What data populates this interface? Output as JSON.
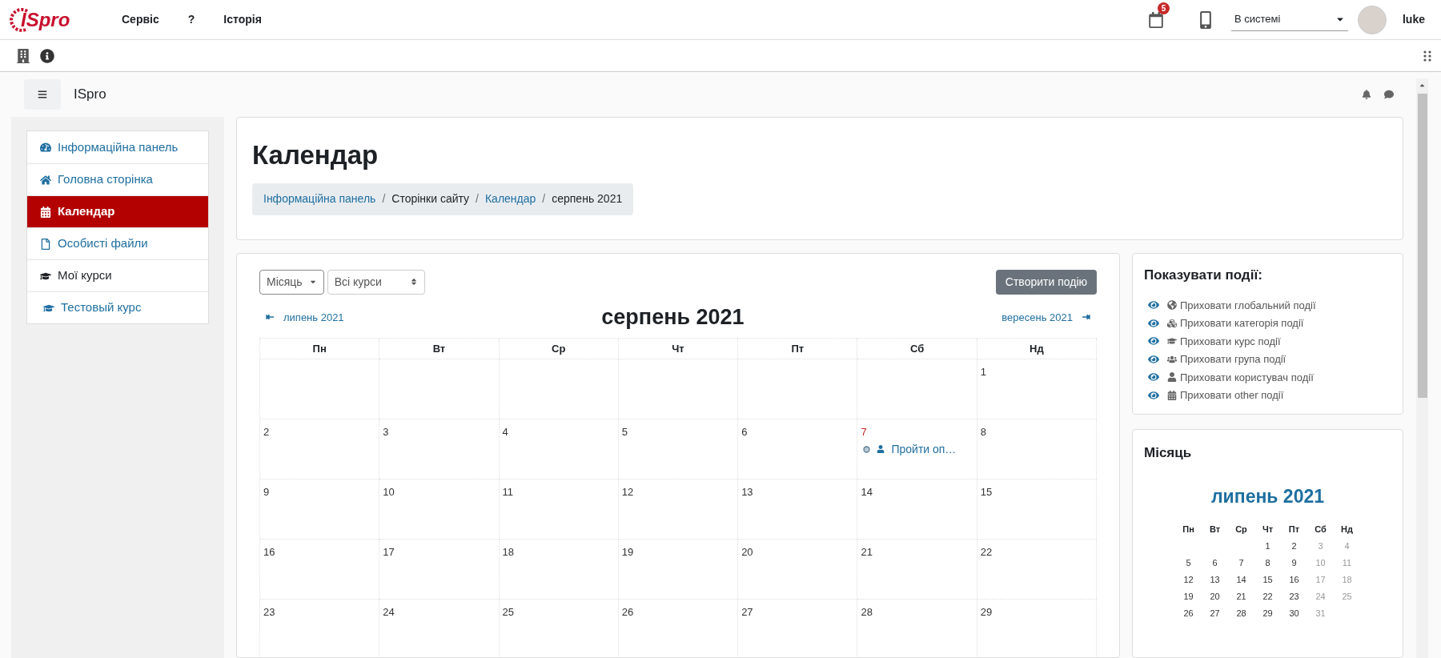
{
  "top_bar": {
    "logo": "ISpro",
    "menu": [
      "Сервіс",
      "?",
      "Історія"
    ],
    "notification_count": "5",
    "status_select": {
      "value": "В системі"
    },
    "user": "luke"
  },
  "header": {
    "title": "ISpro"
  },
  "sidebar": {
    "items": [
      {
        "label": "Інформаційна панель",
        "selected": false
      },
      {
        "label": "Головна сторінка",
        "selected": false
      },
      {
        "label": "Календар",
        "selected": true
      },
      {
        "label": "Особисті файли",
        "selected": false
      },
      {
        "label": "Мої курси",
        "selected": false,
        "children": [
          {
            "label": "Тестовый курс",
            "selected": false
          }
        ]
      }
    ]
  },
  "page": {
    "title": "Календар",
    "breadcrumb_separator": "/",
    "breadcrumb": [
      {
        "label": "Інформаційна панель",
        "link": true
      },
      {
        "label": "Сторінки сайту",
        "link": false
      },
      {
        "label": "Календар",
        "link": true
      },
      {
        "label": "серпень 2021",
        "link": false
      }
    ]
  },
  "calendar": {
    "view_select": "Місяць",
    "course_select": "Всі курси",
    "create_button": "Створити подію",
    "prev": "липень 2021",
    "month_title": "серпень 2021",
    "next": "вересень 2021",
    "weekdays": [
      "Пн",
      "Вт",
      "Ср",
      "Чт",
      "Пт",
      "Сб",
      "Нд"
    ],
    "weeks": [
      [
        {
          "kind": "empty"
        },
        {
          "kind": "empty"
        },
        {
          "kind": "empty"
        },
        {
          "kind": "empty"
        },
        {
          "kind": "empty"
        },
        {
          "kind": "empty"
        },
        {
          "kind": "day",
          "day": "1",
          "highlighted": false
        }
      ],
      [
        {
          "kind": "day",
          "day": "2",
          "highlighted": false
        },
        {
          "kind": "day",
          "day": "3",
          "highlighted": false
        },
        {
          "kind": "day",
          "day": "4",
          "highlighted": false
        },
        {
          "kind": "day",
          "day": "5",
          "highlighted": false
        },
        {
          "kind": "day",
          "day": "6",
          "highlighted": false
        },
        {
          "kind": "day",
          "day": "7",
          "highlighted": true,
          "events": [
            {
              "title": "Пройти оп…"
            }
          ]
        },
        {
          "kind": "day",
          "day": "8",
          "highlighted": false
        }
      ],
      [
        {
          "kind": "day",
          "day": "9",
          "highlighted": false
        },
        {
          "kind": "day",
          "day": "10",
          "highlighted": false
        },
        {
          "kind": "day",
          "day": "11",
          "highlighted": false
        },
        {
          "kind": "day",
          "day": "12",
          "highlighted": false
        },
        {
          "kind": "day",
          "day": "13",
          "highlighted": false
        },
        {
          "kind": "day",
          "day": "14",
          "highlighted": false
        },
        {
          "kind": "day",
          "day": "15",
          "highlighted": false
        }
      ],
      [
        {
          "kind": "day",
          "day": "16",
          "highlighted": false
        },
        {
          "kind": "day",
          "day": "17",
          "highlighted": false
        },
        {
          "kind": "day",
          "day": "18",
          "highlighted": false
        },
        {
          "kind": "day",
          "day": "19",
          "highlighted": false
        },
        {
          "kind": "day",
          "day": "20",
          "highlighted": false
        },
        {
          "kind": "day",
          "day": "21",
          "highlighted": false
        },
        {
          "kind": "day",
          "day": "22",
          "highlighted": false
        }
      ],
      [
        {
          "kind": "day",
          "day": "23",
          "highlighted": false
        },
        {
          "kind": "day",
          "day": "24",
          "highlighted": false
        },
        {
          "kind": "day",
          "day": "25",
          "highlighted": false
        },
        {
          "kind": "day",
          "day": "26",
          "highlighted": false
        },
        {
          "kind": "day",
          "day": "27",
          "highlighted": false
        },
        {
          "kind": "day",
          "day": "28",
          "highlighted": false
        },
        {
          "kind": "day",
          "day": "29",
          "highlighted": false
        }
      ]
    ]
  },
  "event_filter": {
    "title": "Показувати події:",
    "items": [
      "Приховати глобальний події",
      "Приховати категорія події",
      "Приховати курс події",
      "Приховати група події",
      "Приховати користувач події",
      "Приховати other події"
    ]
  },
  "month_block": {
    "title": "Місяць",
    "month": "липень 2021",
    "weekdays": [
      "Пн",
      "Вт",
      "Ср",
      "Чт",
      "Пт",
      "Сб",
      "Нд"
    ],
    "weeks": [
      [
        {
          "kind": "empty"
        },
        {
          "kind": "empty"
        },
        {
          "kind": "empty"
        },
        {
          "kind": "day",
          "day": "1"
        },
        {
          "kind": "day",
          "day": "2"
        },
        {
          "kind": "day",
          "day": "3"
        },
        {
          "kind": "day",
          "day": "4"
        }
      ],
      [
        {
          "kind": "day",
          "day": "5"
        },
        {
          "kind": "day",
          "day": "6"
        },
        {
          "kind": "day",
          "day": "7"
        },
        {
          "kind": "day",
          "day": "8"
        },
        {
          "kind": "day",
          "day": "9"
        },
        {
          "kind": "day",
          "day": "10"
        },
        {
          "kind": "day",
          "day": "11"
        }
      ],
      [
        {
          "kind": "day",
          "day": "12"
        },
        {
          "kind": "day",
          "day": "13"
        },
        {
          "kind": "day",
          "day": "14"
        },
        {
          "kind": "day",
          "day": "15"
        },
        {
          "kind": "day",
          "day": "16"
        },
        {
          "kind": "day",
          "day": "17"
        },
        {
          "kind": "day",
          "day": "18"
        }
      ],
      [
        {
          "kind": "day",
          "day": "19"
        },
        {
          "kind": "day",
          "day": "20"
        },
        {
          "kind": "day",
          "day": "21"
        },
        {
          "kind": "day",
          "day": "22"
        },
        {
          "kind": "day",
          "day": "23"
        },
        {
          "kind": "day",
          "day": "24"
        },
        {
          "kind": "day",
          "day": "25"
        }
      ],
      [
        {
          "kind": "day",
          "day": "26"
        },
        {
          "kind": "day",
          "day": "27"
        },
        {
          "kind": "day",
          "day": "28"
        },
        {
          "kind": "day",
          "day": "29"
        },
        {
          "kind": "day",
          "day": "30"
        },
        {
          "kind": "day",
          "day": "31"
        },
        {
          "kind": "empty"
        }
      ]
    ]
  }
}
